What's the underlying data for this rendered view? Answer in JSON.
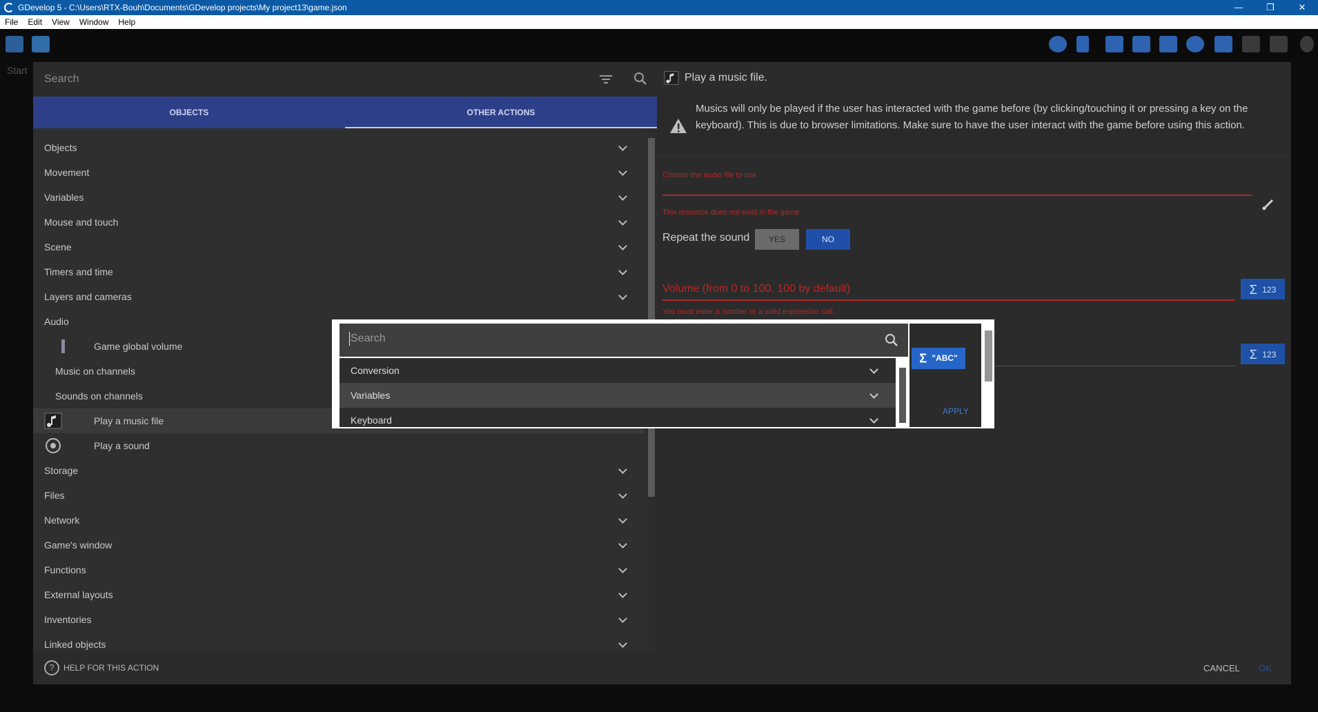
{
  "window": {
    "title": "GDevelop 5 - C:\\Users\\RTX-Bouh\\Documents\\GDevelop projects\\My project13\\game.json",
    "controls": [
      "—",
      "❐",
      "✕"
    ]
  },
  "menu": [
    "File",
    "Edit",
    "View",
    "Window",
    "Help"
  ],
  "background": {
    "start_label": "Start"
  },
  "left": {
    "search_placeholder": "Search",
    "tabs": [
      "OBJECTS",
      "OTHER ACTIONS"
    ],
    "items": [
      {
        "label": "Objects"
      },
      {
        "label": "Movement"
      },
      {
        "label": "Variables"
      },
      {
        "label": "Mouse and touch"
      },
      {
        "label": "Scene"
      },
      {
        "label": "Timers and time"
      },
      {
        "label": "Layers and cameras"
      },
      {
        "label": "Audio"
      },
      {
        "label": "Game global volume"
      },
      {
        "label": "Music on channels"
      },
      {
        "label": "Sounds on channels"
      },
      {
        "label": "Play a music file"
      },
      {
        "label": "Play a sound"
      },
      {
        "label": "Storage"
      },
      {
        "label": "Files"
      },
      {
        "label": "Network"
      },
      {
        "label": "Game's window"
      },
      {
        "label": "Functions"
      },
      {
        "label": "External layouts"
      },
      {
        "label": "Inventories"
      },
      {
        "label": "Linked objects"
      }
    ],
    "help_label": "HELP FOR THIS ACTION"
  },
  "right": {
    "action_title": "Play a music file.",
    "warning": "Musics will only be played if the user has interacted with the game before (by clicking/touching it or pressing a key on the keyboard). This is due to browser limitations. Make sure to have the user interact with the game before using this action.",
    "audio_label": "Choose the audio file to use",
    "audio_error": "This resource does not exist in the game",
    "repeat_label": "Repeat the sound",
    "yes": "YES",
    "no": "NO",
    "volume_placeholder": "Volume (from 0 to 100, 100 by default)",
    "volume_error": "You must enter a number or a valid expression call.",
    "expr_btn": "123",
    "cancel": "CANCEL",
    "ok": "OK"
  },
  "popup": {
    "search_placeholder": "Search",
    "items": [
      "Conversion",
      "Variables",
      "Keyboard"
    ],
    "abc_button": "\"ABC\"",
    "apply": "APPLY"
  },
  "colors": {
    "title_bar": "#0c5aa6",
    "tabs": "#2e3f8a",
    "error": "#b32828",
    "accent_blue": "#2766c9"
  }
}
